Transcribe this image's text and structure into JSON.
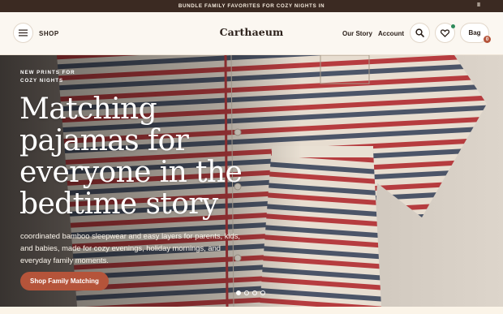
{
  "announcement": {
    "text": "BUNDLE FAMILY FAVORITES FOR COZY NIGHTS IN",
    "pause_label": "II"
  },
  "header": {
    "shop_label": "SHOP",
    "logo": "Carthaeum",
    "nav": [
      {
        "label": "Our Story"
      },
      {
        "label": "Account"
      }
    ],
    "bag_label": "Bag",
    "bag_count": "0"
  },
  "hero": {
    "eyebrow": "NEW PRINTS FOR COZY NIGHTS",
    "headline": "Matching pajamas for everyone in the bedtime story",
    "subtext": "coordinated bamboo sleepwear and easy layers for parents, kids, and babies, made for cozy evenings, holiday mornings, and everyday family moments.",
    "cta_label": "Shop Family Matching",
    "slide_count": 4,
    "active_slide": 1
  },
  "colors": {
    "announcement_bg": "#3b2a22",
    "accent": "#b5543a",
    "stripe_red": "#b63c3f",
    "stripe_navy": "#4c5568",
    "fabric": "#e7ddd0"
  },
  "icons": [
    "menu-icon",
    "search-icon",
    "heart-icon",
    "pause-icon"
  ]
}
